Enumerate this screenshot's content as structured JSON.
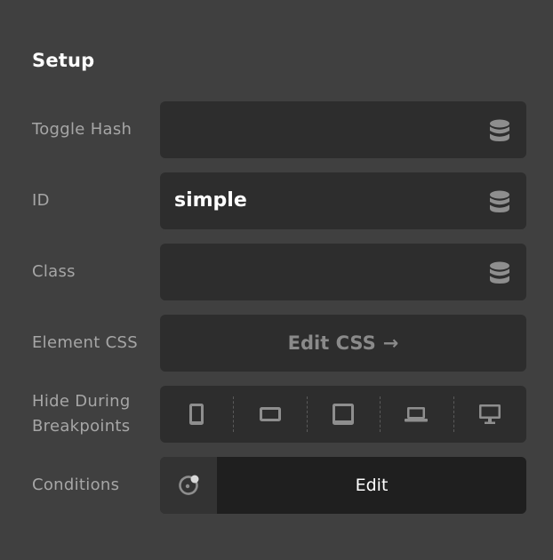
{
  "section": {
    "title": "Setup"
  },
  "fields": {
    "toggle_hash": {
      "label": "Toggle Hash",
      "value": "",
      "icon": "database-icon"
    },
    "id": {
      "label": "ID",
      "value": "simple",
      "icon": "database-icon"
    },
    "class": {
      "label": "Class",
      "value": "",
      "icon": "database-icon"
    }
  },
  "element_css": {
    "label": "Element CSS",
    "button_label": "Edit CSS",
    "arrow": "→"
  },
  "breakpoints": {
    "label": "Hide During Breakpoints",
    "devices": [
      "phone-icon",
      "tablet-landscape-icon",
      "tablet-icon",
      "laptop-icon",
      "desktop-icon"
    ]
  },
  "conditions": {
    "label": "Conditions",
    "icon": "conditions-icon",
    "button_label": "Edit"
  },
  "colors": {
    "background": "#404040",
    "control": "#2d2d2d",
    "edit_button": "#1f1f1f",
    "icon": "#8e8e8e"
  }
}
